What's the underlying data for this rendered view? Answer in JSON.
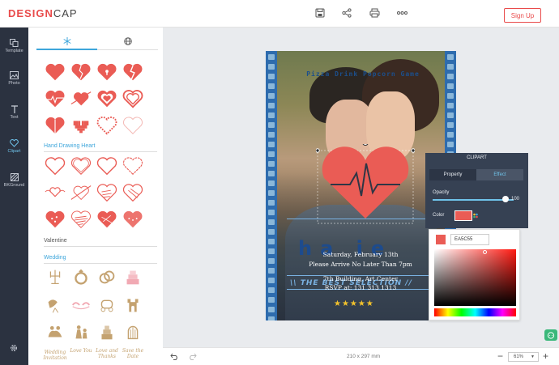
{
  "app": {
    "logo": "DESIGNCAP",
    "signup_label": "Sign Up"
  },
  "toolbar": {
    "icons": [
      "save-icon",
      "share-icon",
      "print-icon",
      "more-icon"
    ]
  },
  "rail": [
    {
      "label": "Template",
      "icon": "template-icon"
    },
    {
      "label": "Photo",
      "icon": "photo-icon"
    },
    {
      "label": "Text",
      "icon": "text-icon"
    },
    {
      "label": "Clipart",
      "icon": "clipart-icon",
      "active": true
    },
    {
      "label": "BKGround",
      "icon": "background-icon"
    }
  ],
  "panel": {
    "tabs": [
      "snowflake-icon",
      "globe-icon"
    ],
    "sections": {
      "hand_drawing_heart": "Hand Drawing Heart",
      "valentine": "Valentine",
      "wedding": "Wedding"
    },
    "wedding_text": [
      "Wedding Invitation",
      "Love You",
      "Love and Thanks",
      "Save the Date"
    ]
  },
  "poster": {
    "title": "Pizza Drink Popcorn Game",
    "big_text": "ha    ie",
    "subtitle": "\\\\ THE BEST SELECTION //",
    "date": "Saturday, February 13th",
    "arrive": "Please Arrive No Later Than 7pm",
    "address": "7th Building, Art Center",
    "rsvp": "RSVP at: 131 313 1313",
    "stars": "★★★★★"
  },
  "clipart_panel": {
    "title": "CLIPART",
    "tab_property": "Property",
    "tab_effect": "Effect",
    "opacity_label": "Opacity",
    "opacity_value": "100",
    "color_label": "Color",
    "color_value": "#EA5C55",
    "hex_text": "EA5C55"
  },
  "bottom": {
    "page_size": "210 x 297 mm",
    "zoom": "61%",
    "zoom_minus": "−",
    "zoom_plus": "+"
  },
  "colors": {
    "accent": "#e94b4b",
    "blue": "#3ea6db",
    "heart": "#ea5c55",
    "rail": "#2b3240"
  }
}
